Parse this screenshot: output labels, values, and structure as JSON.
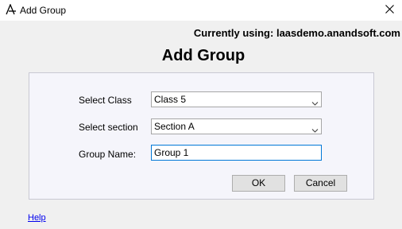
{
  "window": {
    "title": "Add Group",
    "app_icon": "app-logo-icon",
    "close_icon": "close-icon"
  },
  "header": {
    "current_using_label": "Currently using:",
    "current_using_value": "laasdemo.anandsoft.com",
    "heading": "Add Group"
  },
  "form": {
    "select_class_label": "Select Class",
    "select_class_value": "Class 5",
    "select_section_label": "Select section",
    "select_section_value": "Section A",
    "group_name_label": "Group Name:",
    "group_name_value": "Group 1"
  },
  "buttons": {
    "ok_label": "OK",
    "cancel_label": "Cancel"
  },
  "footer": {
    "help_label": "Help"
  },
  "colors": {
    "panel_bg": "#f5f5fb",
    "focus_border": "#0078d7",
    "link": "#0000ee"
  }
}
